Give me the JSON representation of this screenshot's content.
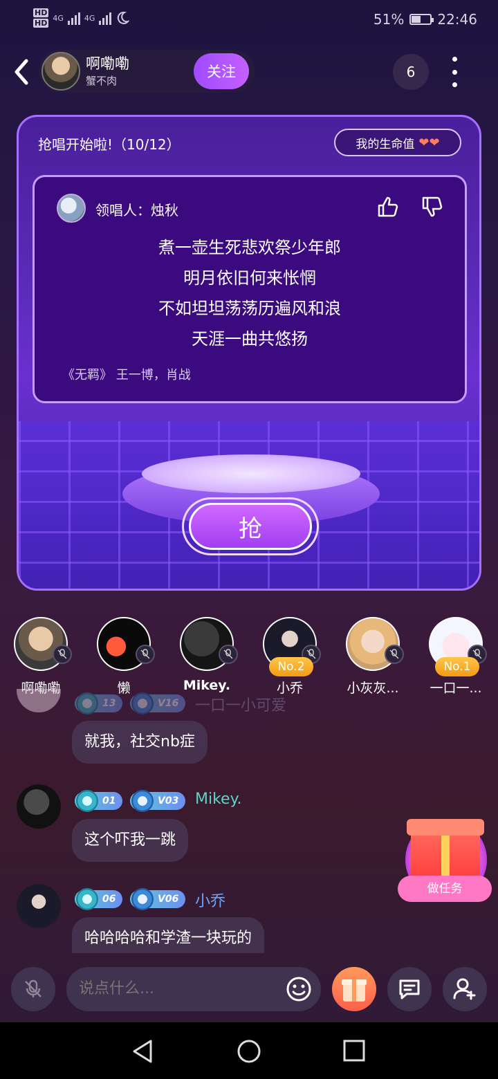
{
  "status": {
    "hd1": "HD",
    "hd2": "HD",
    "net1": "4G",
    "net2": "4G",
    "battery": "51%",
    "battery_level": 0.51,
    "time": "22:46"
  },
  "header": {
    "host_name": "啊嘞嘞",
    "host_sub": "蟹不肉",
    "follow_label": "关注",
    "viewer_count": "6"
  },
  "stage": {
    "title": "抢唱开始啦!（10/12）",
    "life_label": "我的生命值",
    "lives": 2,
    "leader_label": "领唱人：烛秋",
    "lyrics": [
      "煮一壶生死悲欢祭少年郎",
      "明月依旧何来怅惘",
      "不如坦坦荡荡历遍风和浪",
      "天涯一曲共悠扬"
    ],
    "song_info": "《无羁》 王一博，肖战",
    "grab_label": "抢"
  },
  "participants": [
    {
      "name": "啊嘞嘞",
      "rank": ""
    },
    {
      "name": "懒",
      "rank": ""
    },
    {
      "name": "Mikey.",
      "rank": ""
    },
    {
      "name": "小乔",
      "rank": "No.2"
    },
    {
      "name": "小灰灰...",
      "rank": ""
    },
    {
      "name": "一口一...",
      "rank": "No.1"
    }
  ],
  "chat": [
    {
      "user": "一口一小可爱",
      "level": "13",
      "vip": "V16",
      "text": "就我，社交nb症",
      "name_color": "#8f86a8"
    },
    {
      "user": "Mikey.",
      "level": "01",
      "vip": "V03",
      "text": "这个吓我一跳",
      "name_color": "#5fd3c8"
    },
    {
      "user": "小乔",
      "level": "06",
      "vip": "V06",
      "text": "哈哈哈哈和学渣一块玩的",
      "name_color": "#6aa8ff"
    }
  ],
  "task": {
    "label": "做任务"
  },
  "input": {
    "placeholder": "说点什么..."
  }
}
